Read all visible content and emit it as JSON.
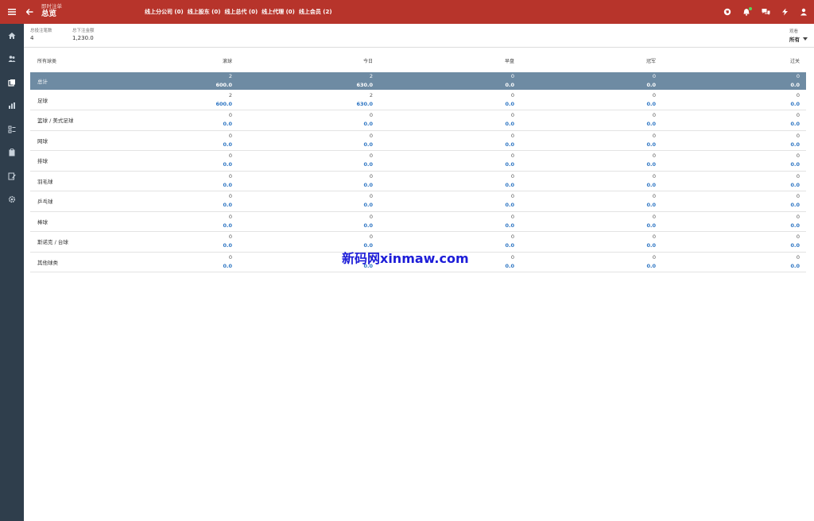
{
  "topbar": {
    "crumb": "即时注单",
    "title": "总览",
    "online_links": [
      "线上分公司 (0)",
      "线上股东 (0)",
      "线上总代 (0)",
      "线上代理 (0)",
      "线上会员 (2)"
    ]
  },
  "stats": {
    "bet_count_label": "总投注笔数",
    "bet_count": "4",
    "bet_amount_label": "总下注金额",
    "bet_amount": "1,230.0"
  },
  "filter": {
    "label": "观看",
    "value": "所有"
  },
  "table": {
    "headers": [
      "所有球类",
      "滚球",
      "今日",
      "早盘",
      "冠军",
      "过关"
    ],
    "total": {
      "label": "总计",
      "cells": [
        [
          "2",
          "600.0"
        ],
        [
          "2",
          "630.0"
        ],
        [
          "0",
          "0.0"
        ],
        [
          "0",
          "0.0"
        ],
        [
          "0",
          "0.0"
        ]
      ]
    },
    "rows": [
      {
        "label": "足球",
        "cells": [
          [
            "2",
            "600.0"
          ],
          [
            "2",
            "630.0"
          ],
          [
            "0",
            "0.0"
          ],
          [
            "0",
            "0.0"
          ],
          [
            "0",
            "0.0"
          ]
        ]
      },
      {
        "label": "篮球 / 美式足球",
        "cells": [
          [
            "0",
            "0.0"
          ],
          [
            "0",
            "0.0"
          ],
          [
            "0",
            "0.0"
          ],
          [
            "0",
            "0.0"
          ],
          [
            "0",
            "0.0"
          ]
        ]
      },
      {
        "label": "网球",
        "cells": [
          [
            "0",
            "0.0"
          ],
          [
            "0",
            "0.0"
          ],
          [
            "0",
            "0.0"
          ],
          [
            "0",
            "0.0"
          ],
          [
            "0",
            "0.0"
          ]
        ]
      },
      {
        "label": "排球",
        "cells": [
          [
            "0",
            "0.0"
          ],
          [
            "0",
            "0.0"
          ],
          [
            "0",
            "0.0"
          ],
          [
            "0",
            "0.0"
          ],
          [
            "0",
            "0.0"
          ]
        ]
      },
      {
        "label": "羽毛球",
        "cells": [
          [
            "0",
            "0.0"
          ],
          [
            "0",
            "0.0"
          ],
          [
            "0",
            "0.0"
          ],
          [
            "0",
            "0.0"
          ],
          [
            "0",
            "0.0"
          ]
        ]
      },
      {
        "label": "乒乓球",
        "cells": [
          [
            "0",
            "0.0"
          ],
          [
            "0",
            "0.0"
          ],
          [
            "0",
            "0.0"
          ],
          [
            "0",
            "0.0"
          ],
          [
            "0",
            "0.0"
          ]
        ]
      },
      {
        "label": "棒球",
        "cells": [
          [
            "0",
            "0.0"
          ],
          [
            "0",
            "0.0"
          ],
          [
            "0",
            "0.0"
          ],
          [
            "0",
            "0.0"
          ],
          [
            "0",
            "0.0"
          ]
        ]
      },
      {
        "label": "斯诺克 / 台球",
        "cells": [
          [
            "0",
            "0.0"
          ],
          [
            "0",
            "0.0"
          ],
          [
            "0",
            "0.0"
          ],
          [
            "0",
            "0.0"
          ],
          [
            "0",
            "0.0"
          ]
        ]
      },
      {
        "label": "其他球类",
        "cells": [
          [
            "0",
            "0.0"
          ],
          [
            "0",
            "0.0"
          ],
          [
            "0",
            "0.0"
          ],
          [
            "0",
            "0.0"
          ],
          [
            "0",
            "0.0"
          ]
        ]
      }
    ]
  },
  "watermark": "新码网xinmaw.com",
  "icons": {
    "sidebar": [
      "home-icon",
      "users-icon",
      "copy-icon",
      "bar-chart-icon",
      "list-icon",
      "clipboard-icon",
      "report-icon",
      "settings-icon"
    ],
    "top": [
      "globe-icon",
      "bell-icon",
      "chat-icon",
      "flash-icon",
      "user-icon"
    ]
  },
  "colors": {
    "brand_red": "#b7342b",
    "sidebar": "#2f3e4c",
    "total_row": "#6e8ba3",
    "amount_blue": "#2c74c2"
  }
}
